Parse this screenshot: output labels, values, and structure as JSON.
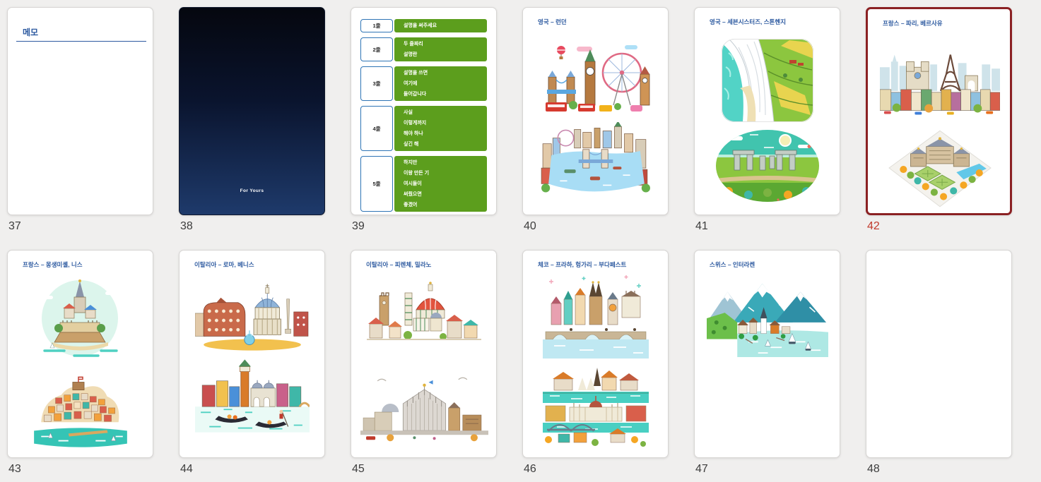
{
  "view": {
    "name": "slide-sorter-grid",
    "background_color": "#f0efee",
    "accent_blue": "#2d5aa0",
    "selected_border_color": "#8b2123",
    "selected_number_color": "#c1392b",
    "list_green": "#5c9e1d"
  },
  "slides": [
    {
      "number": "37",
      "selected": false,
      "type": "memo",
      "title": "메모"
    },
    {
      "number": "38",
      "selected": false,
      "type": "cover",
      "footer": "For Yours"
    },
    {
      "number": "39",
      "selected": false,
      "type": "list",
      "rows": [
        {
          "label": "1줄",
          "lines": [
            "설명을 써주세요"
          ]
        },
        {
          "label": "2줄",
          "lines": [
            "두 줄짜리",
            "설명란"
          ]
        },
        {
          "label": "3줄",
          "lines": [
            "설명을 쓰면",
            "여기에",
            "들어갑니다"
          ]
        },
        {
          "label": "4줄",
          "lines": [
            "사실",
            "이렇게까지",
            "해야 하나",
            "싶긴 해"
          ]
        },
        {
          "label": "5줄",
          "lines": [
            "하지만",
            "이왕 만든 기",
            "여시들이",
            "써줬으면",
            "좋겠어"
          ]
        }
      ]
    },
    {
      "number": "40",
      "selected": false,
      "type": "pictures",
      "title": "영국 – 런던",
      "illustrations": [
        "london-landmarks-illustration",
        "thames-tower-bridge-illustration"
      ]
    },
    {
      "number": "41",
      "selected": false,
      "type": "pictures",
      "title": "영국 – 세븐시스터즈, 스톤헨지",
      "illustrations": [
        "seven-sisters-cliffs-illustration",
        "stonehenge-illustration"
      ]
    },
    {
      "number": "42",
      "selected": true,
      "type": "pictures",
      "title": "프랑스 – 파리, 베르사유",
      "illustrations": [
        "paris-skyline-illustration",
        "versailles-palace-illustration"
      ]
    },
    {
      "number": "43",
      "selected": false,
      "type": "pictures",
      "title": "프랑스 – 몽생미셸, 니스",
      "illustrations": [
        "mont-saint-michel-illustration",
        "nice-coast-illustration"
      ]
    },
    {
      "number": "44",
      "selected": false,
      "type": "pictures",
      "title": "이탈리아 – 로마, 베니스",
      "illustrations": [
        "rome-landmarks-illustration",
        "venice-gondola-illustration"
      ]
    },
    {
      "number": "45",
      "selected": false,
      "type": "pictures",
      "title": "이탈리아 – 피렌체, 밀라노",
      "illustrations": [
        "florence-duomo-illustration",
        "milan-duomo-illustration"
      ]
    },
    {
      "number": "46",
      "selected": false,
      "type": "pictures",
      "title": "체코 – 프라하, 헝가리 – 부다페스트",
      "illustrations": [
        "prague-skyline-illustration",
        "budapest-danube-illustration"
      ]
    },
    {
      "number": "47",
      "selected": false,
      "type": "pictures",
      "title": "스위스 – 인터라켄",
      "illustrations": [
        "interlaken-lake-illustration"
      ]
    },
    {
      "number": "48",
      "selected": false,
      "type": "blank"
    }
  ]
}
